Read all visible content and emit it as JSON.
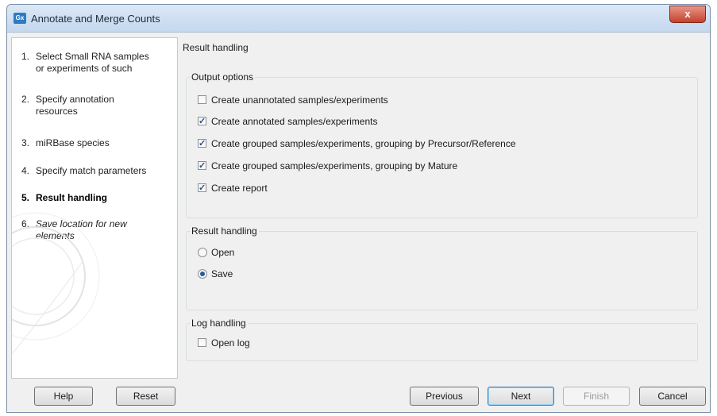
{
  "window": {
    "title": "Annotate and Merge Counts",
    "app_icon": "Gx",
    "close_label": "x"
  },
  "sidebar": {
    "steps": [
      {
        "num": "1.",
        "label": "Select Small RNA samples\nor experiments of such"
      },
      {
        "num": "2.",
        "label": "Specify annotation\nresources"
      },
      {
        "num": "3.",
        "label": "miRBase species"
      },
      {
        "num": "4.",
        "label": "Specify match parameters"
      },
      {
        "num": "5.",
        "label": "Result handling"
      },
      {
        "num": "6.",
        "label": "Save location for new\nelements"
      }
    ],
    "current_step": 5
  },
  "main": {
    "title": "Result handling",
    "output_options": {
      "title": "Output options",
      "items": [
        {
          "label": "Create unannotated samples/experiments",
          "checked": false
        },
        {
          "label": "Create annotated samples/experiments",
          "checked": true
        },
        {
          "label": "Create grouped samples/experiments, grouping by Precursor/Reference",
          "checked": true
        },
        {
          "label": "Create grouped samples/experiments, grouping by Mature",
          "checked": true
        },
        {
          "label": "Create report",
          "checked": true
        }
      ]
    },
    "result_handling": {
      "title": "Result handling",
      "options": [
        {
          "label": "Open",
          "selected": false
        },
        {
          "label": "Save",
          "selected": true
        }
      ]
    },
    "log_handling": {
      "title": "Log handling",
      "open_log": {
        "label": "Open log",
        "checked": false
      }
    }
  },
  "buttons": {
    "help": "Help",
    "reset": "Reset",
    "previous": "Previous",
    "next": "Next",
    "finish": "Finish",
    "cancel": "Cancel"
  },
  "colors": {
    "accent": "#2d7bc4",
    "close": "#c7402b",
    "panel": "#f0f0f0"
  }
}
